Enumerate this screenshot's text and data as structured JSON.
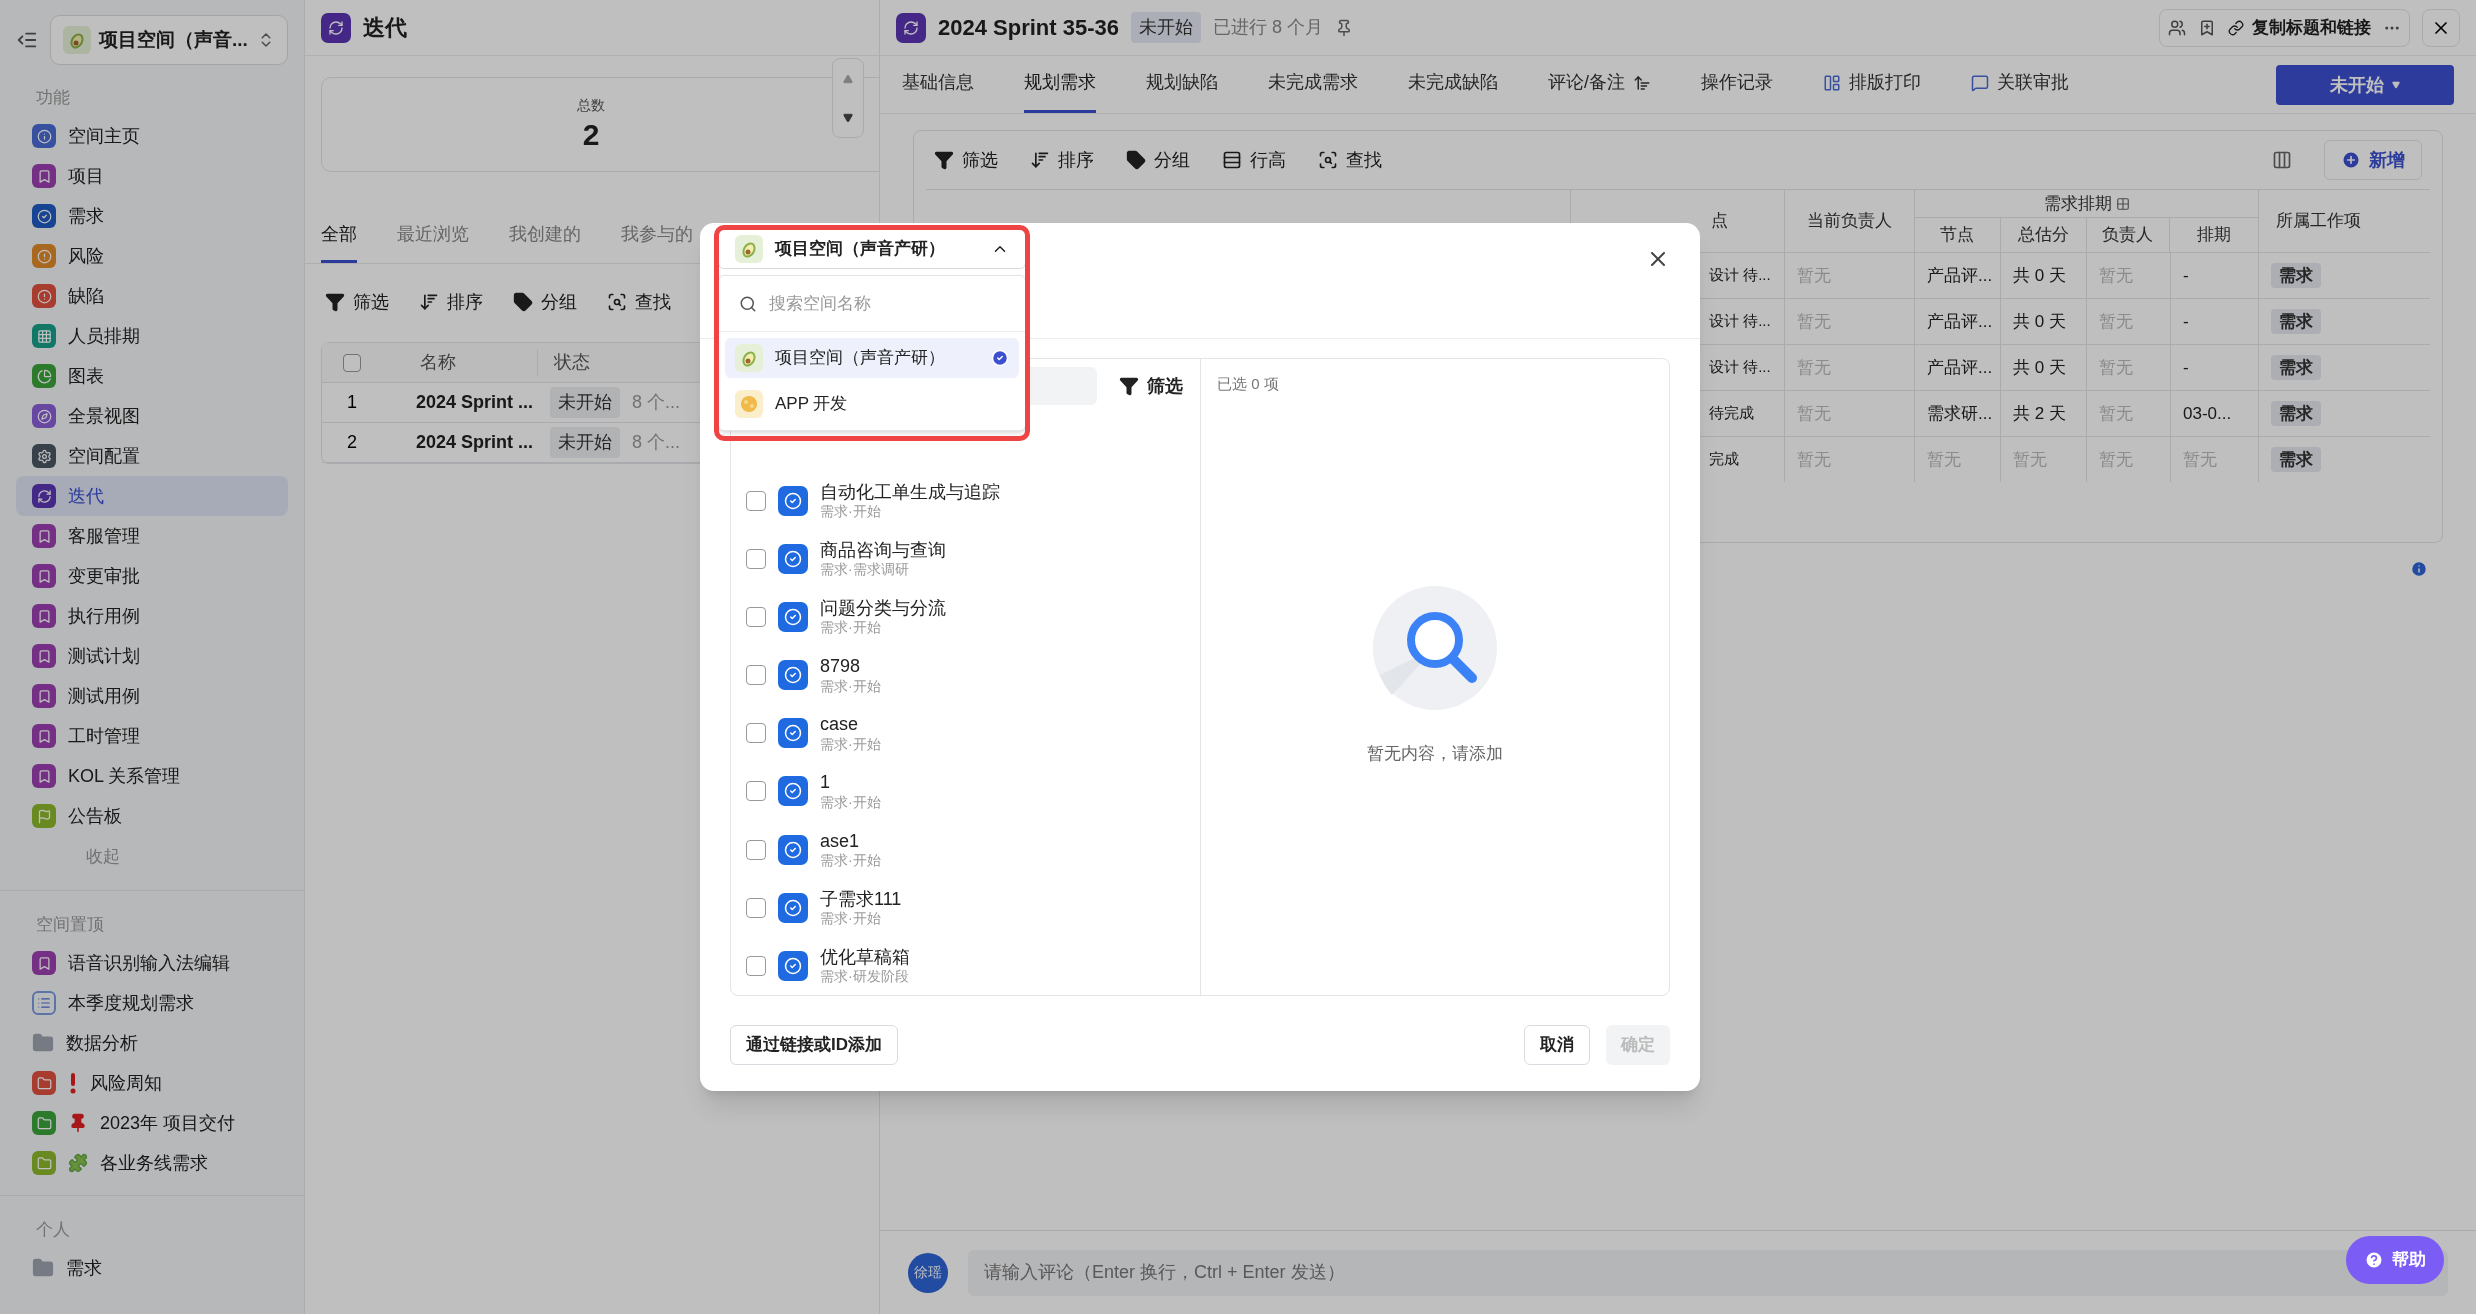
{
  "sidebar": {
    "space_switcher": "项目空间（声音...",
    "sections": [
      {
        "title": "功能",
        "collapse": "收起",
        "items": [
          {
            "label": "空间主页",
            "kind": "app",
            "color": "#38519f",
            "selected": false
          },
          {
            "label": "项目",
            "kind": "app",
            "color": "#752f84",
            "selected": false
          },
          {
            "label": "需求",
            "kind": "app",
            "color": "#174493",
            "selected": false
          },
          {
            "label": "风险",
            "kind": "app",
            "color": "#a86820",
            "selected": false
          },
          {
            "label": "缺陷",
            "kind": "app",
            "color": "#a83c2e",
            "selected": false
          },
          {
            "label": "人员排期",
            "kind": "app",
            "color": "#117868",
            "selected": false
          },
          {
            "label": "图表",
            "kind": "app",
            "color": "#2c7a2c",
            "selected": false
          },
          {
            "label": "全景视图",
            "kind": "app",
            "color": "#6847a2",
            "selected": false
          },
          {
            "label": "空间配置",
            "kind": "app",
            "color": "#38404a",
            "selected": false
          },
          {
            "label": "迭代",
            "kind": "app",
            "color": "#442888",
            "selected": true
          },
          {
            "label": "客服管理",
            "kind": "app",
            "color": "#752f84",
            "selected": false
          },
          {
            "label": "变更审批",
            "kind": "app",
            "color": "#752f84",
            "selected": false
          },
          {
            "label": "执行用例",
            "kind": "app",
            "color": "#752f84",
            "selected": false
          },
          {
            "label": "测试计划",
            "kind": "app",
            "color": "#752f84",
            "selected": false
          },
          {
            "label": "测试用例",
            "kind": "app",
            "color": "#752f84",
            "selected": false
          },
          {
            "label": "工时管理",
            "kind": "app",
            "color": "#752f84",
            "selected": false
          },
          {
            "label": "KOL 关系管理",
            "kind": "app",
            "color": "#752f84",
            "selected": false
          },
          {
            "label": "公告板",
            "kind": "app",
            "color": "#688a21",
            "selected": false
          }
        ]
      },
      {
        "title": "空间置顶",
        "items": [
          {
            "label": "语音识别输入法编辑",
            "kind": "app",
            "color": "#752f84",
            "selected": false
          },
          {
            "label": "本季度规划需求",
            "kind": "list",
            "selected": false
          },
          {
            "label": "数据分析",
            "kind": "folder",
            "selected": false
          },
          {
            "label": "风险周知",
            "kind": "app",
            "color": "#a83c2e",
            "selected": false
          },
          {
            "label": "2023年 项目交付",
            "kind": "app",
            "color": "#2c7a2c",
            "selected": false
          },
          {
            "label": "各业务线需求",
            "kind": "app",
            "color": "#688a21",
            "selected": false
          }
        ]
      },
      {
        "title": "个人",
        "items": [
          {
            "label": "需求",
            "kind": "folder",
            "selected": false
          }
        ]
      }
    ]
  },
  "list_panel": {
    "title": "迭代",
    "stat_label": "总数",
    "stat_value": "2",
    "tabs": [
      {
        "label": "全部",
        "selected": true
      },
      {
        "label": "最近浏览",
        "selected": false
      },
      {
        "label": "我创建的",
        "selected": false
      },
      {
        "label": "我参与的",
        "selected": false
      }
    ],
    "toolbar": [
      "筛选",
      "排序",
      "分组",
      "查找"
    ],
    "table": {
      "select_all_checked": false,
      "columns": [
        "名称",
        "状态"
      ],
      "rows": [
        {
          "index": "1",
          "name": "2024 Sprint ...",
          "status": "未开始",
          "extra": "8 个..."
        },
        {
          "index": "2",
          "name": "2024 Sprint ...",
          "status": "未开始",
          "extra": "8 个..."
        }
      ]
    }
  },
  "detail": {
    "title": "2024 Sprint 35-36",
    "status": "未开始",
    "elapsed": "已进行 8 个月",
    "copy_link": "复制标题和链接",
    "tabs": [
      {
        "label": "基础信息",
        "selected": false
      },
      {
        "label": "规划需求",
        "selected": true
      },
      {
        "label": "规划缺陷",
        "selected": false
      },
      {
        "label": "未完成需求",
        "selected": false
      },
      {
        "label": "未完成缺陷",
        "selected": false
      },
      {
        "label": "评论/备注",
        "selected": false
      },
      {
        "label": "操作记录",
        "selected": false
      },
      {
        "label": "排版打印",
        "selected": false
      },
      {
        "label": "关联审批",
        "selected": false
      }
    ],
    "state_button": "未开始",
    "toolbar": [
      "筛选",
      "排序",
      "分组",
      "行高",
      "查找"
    ],
    "add_button": "新增",
    "table": {
      "group_header": "需求排期",
      "columns": [
        "点",
        "当前负责人",
        "节点",
        "总估分",
        "负责人",
        "排期",
        "所属工作项"
      ],
      "rows": [
        {
          "cells": [
            {
              "text": "设计 待...",
              "muted": false
            },
            {
              "text": "暂无",
              "muted": true
            },
            {
              "text": "产品评...",
              "muted": false
            },
            {
              "text": "共 0 天",
              "muted": false
            },
            {
              "text": "暂无",
              "muted": true
            },
            {
              "text": "-",
              "muted": false
            },
            {
              "text": "需求",
              "muted": false
            }
          ]
        },
        {
          "cells": [
            {
              "text": "设计 待...",
              "muted": false
            },
            {
              "text": "暂无",
              "muted": true
            },
            {
              "text": "产品评...",
              "muted": false
            },
            {
              "text": "共 0 天",
              "muted": false
            },
            {
              "text": "暂无",
              "muted": true
            },
            {
              "text": "-",
              "muted": false
            },
            {
              "text": "需求",
              "muted": false
            }
          ]
        },
        {
          "cells": [
            {
              "text": "设计 待...",
              "muted": false
            },
            {
              "text": "暂无",
              "muted": true
            },
            {
              "text": "产品评...",
              "muted": false
            },
            {
              "text": "共 0 天",
              "muted": false
            },
            {
              "text": "暂无",
              "muted": true
            },
            {
              "text": "-",
              "muted": false
            },
            {
              "text": "需求",
              "muted": false
            }
          ]
        },
        {
          "cells": [
            {
              "text": "待完成",
              "muted": false
            },
            {
              "text": "暂无",
              "muted": true
            },
            {
              "text": "需求研...",
              "muted": false
            },
            {
              "text": "共 2 天",
              "muted": false
            },
            {
              "text": "暂无",
              "muted": true
            },
            {
              "text": "03-0...",
              "muted": false
            },
            {
              "text": "需求",
              "muted": false
            }
          ]
        },
        {
          "cells": [
            {
              "text": "完成",
              "muted": false
            },
            {
              "text": "暂无",
              "muted": true
            },
            {
              "text": "暂无",
              "muted": true
            },
            {
              "text": "暂无",
              "muted": true
            },
            {
              "text": "暂无",
              "muted": true
            },
            {
              "text": "暂无",
              "muted": true
            },
            {
              "text": "需求",
              "muted": false
            }
          ]
        }
      ]
    },
    "comment": {
      "avatar": "徐瑶",
      "placeholder": "请输入评论（Enter 换行，Ctrl + Enter 发送）"
    },
    "help": "帮助"
  },
  "dialog": {
    "space_select": {
      "value": "项目空间（声音产研）",
      "expanded": true,
      "search_placeholder": "搜索空间名称",
      "options": [
        {
          "label": "项目空间（声音产研）",
          "selected": true
        },
        {
          "label": "APP 开发",
          "selected": false
        }
      ]
    },
    "filter": "筛选",
    "items": [
      {
        "title": "自动化工单生成与追踪",
        "subtitle": "需求·开始",
        "checked": false
      },
      {
        "title": "商品咨询与查询",
        "subtitle": "需求·需求调研",
        "checked": false
      },
      {
        "title": "问题分类与分流",
        "subtitle": "需求·开始",
        "checked": false
      },
      {
        "title": "8798",
        "subtitle": "需求·开始",
        "checked": false
      },
      {
        "title": "case",
        "subtitle": "需求·开始",
        "checked": false
      },
      {
        "title": "1",
        "subtitle": "需求·开始",
        "checked": false
      },
      {
        "title": "ase1",
        "subtitle": "需求·开始",
        "checked": false
      },
      {
        "title": "子需求111",
        "subtitle": "需求·开始",
        "checked": false
      },
      {
        "title": "优化草稿箱",
        "subtitle": "需求·研发阶段",
        "checked": false
      }
    ],
    "selected_count": "已选 0 项",
    "empty_text": "暂无内容，请添加",
    "add_by_link": "通过链接或ID添加",
    "cancel": "取消",
    "confirm": {
      "label": "确定",
      "disabled": true
    }
  }
}
